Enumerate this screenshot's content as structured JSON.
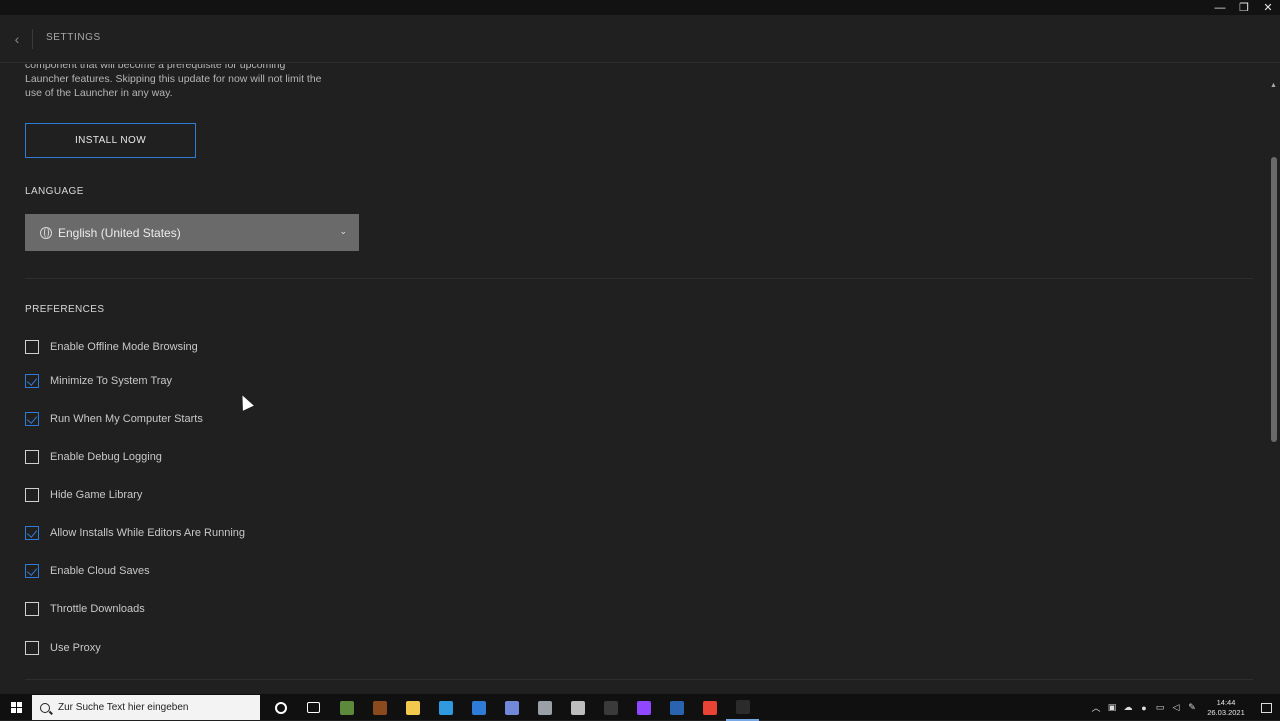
{
  "window": {
    "minimize_label": "—",
    "maximize_label": "❐",
    "close_label": "✕"
  },
  "header": {
    "back_label": "‹",
    "title": "SETTINGS"
  },
  "update": {
    "description": "component that will become a prerequisite for upcoming Launcher features. Skipping this update for now will not limit the use of the Launcher in any way.",
    "install_button": "INSTALL NOW"
  },
  "language": {
    "section_title": "LANGUAGE",
    "selected": "English (United States)",
    "chevron": "⌄"
  },
  "preferences": {
    "section_title": "PREFERENCES",
    "items": [
      {
        "label": "Enable Offline Mode Browsing",
        "checked": false
      },
      {
        "label": "Minimize To System Tray",
        "checked": true
      },
      {
        "label": "Run When My Computer Starts",
        "checked": true
      },
      {
        "label": "Enable Debug Logging",
        "checked": false
      },
      {
        "label": "Hide Game Library",
        "checked": false
      },
      {
        "label": "Allow Installs While Editors Are Running",
        "checked": true
      },
      {
        "label": "Enable Cloud Saves",
        "checked": true
      },
      {
        "label": "Throttle Downloads",
        "checked": false
      },
      {
        "label": "Use Proxy",
        "checked": false
      }
    ]
  },
  "taskbar": {
    "search_placeholder": "Zur Suche Text hier eingeben",
    "apps": [
      {
        "name": "cortana-icon",
        "color": "#ffffff"
      },
      {
        "name": "task-view-icon",
        "color": "#ffffff"
      },
      {
        "name": "minecraft-icon",
        "color": "#5d8a3a"
      },
      {
        "name": "minecraft-dungeons-icon",
        "color": "#8a4a1e"
      },
      {
        "name": "file-explorer-icon",
        "color": "#f2c94c"
      },
      {
        "name": "edge-icon",
        "color": "#2f9ae0"
      },
      {
        "name": "mail-icon",
        "color": "#2f7bd8"
      },
      {
        "name": "discord-icon",
        "color": "#7289da"
      },
      {
        "name": "app-icon",
        "color": "#9aa0a6"
      },
      {
        "name": "app-icon-2",
        "color": "#bdbdbd"
      },
      {
        "name": "obs-icon",
        "color": "#3a3a3a"
      },
      {
        "name": "twitch-icon",
        "color": "#9146ff"
      },
      {
        "name": "cpuz-icon",
        "color": "#2a64b0"
      },
      {
        "name": "chrome-icon",
        "color": "#e84335"
      },
      {
        "name": "epic-games-icon",
        "color": "#2b2b2b"
      }
    ],
    "time": "14:44",
    "date": "26.03.2021"
  }
}
